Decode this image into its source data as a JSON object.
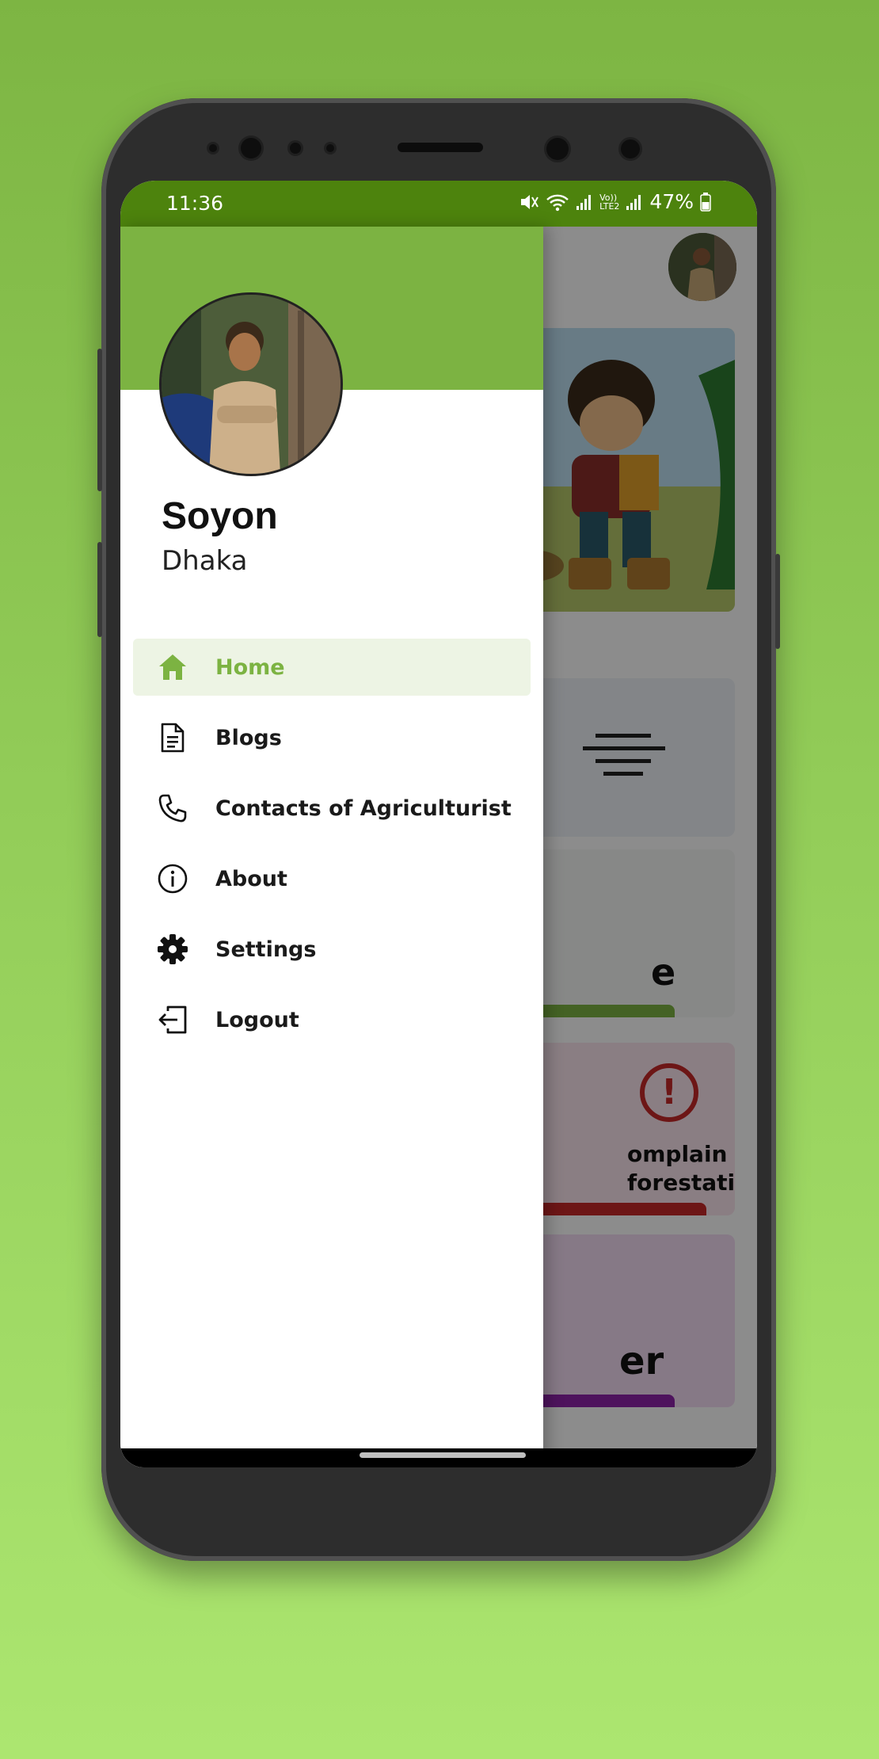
{
  "status_bar": {
    "time": "11:36",
    "battery_percent": "47%",
    "network_label_top": "Vo))",
    "network_label_bottom": "LTE2"
  },
  "drawer": {
    "user_name": "Soyon",
    "user_location": "Dhaka",
    "menu": [
      {
        "label": "Home",
        "icon": "home-icon",
        "active": true
      },
      {
        "label": "Blogs",
        "icon": "document-icon",
        "active": false
      },
      {
        "label": "Contacts of Agriculturist",
        "icon": "phone-icon",
        "active": false
      },
      {
        "label": "About",
        "icon": "info-icon",
        "active": false
      },
      {
        "label": "Settings",
        "icon": "gear-icon",
        "active": false
      },
      {
        "label": "Logout",
        "icon": "logout-icon",
        "active": false
      }
    ]
  },
  "background_screen": {
    "card_text_1": "e",
    "card_text_2_line1": "omplain",
    "card_text_2_line2": "forestation",
    "card_text_3": "er"
  },
  "colors": {
    "brand_green": "#7cb342",
    "status_green": "#4d830d",
    "active_bg": "#edf4e4",
    "complain_red": "#c62828",
    "purple": "#8e24aa"
  }
}
